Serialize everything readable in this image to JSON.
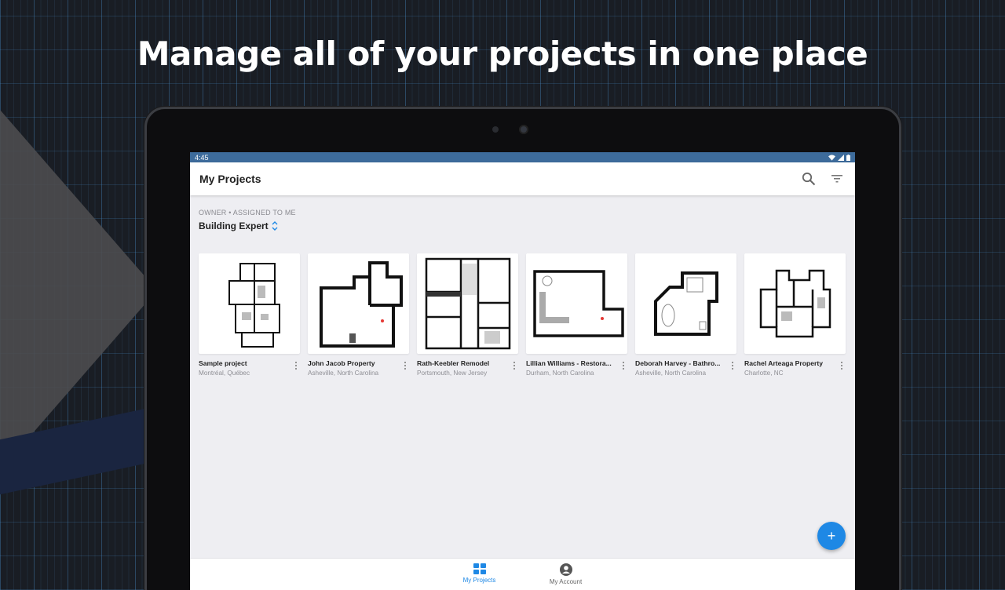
{
  "headline": "Manage all of your projects in one place",
  "status_bar": {
    "time": "4:45"
  },
  "app_bar": {
    "title": "My Projects",
    "search_icon": "search-icon",
    "filter_icon": "filter-icon"
  },
  "filter": {
    "label": "OWNER • ASSIGNED TO ME",
    "value": "Building Expert"
  },
  "projects": [
    {
      "title": "Sample project",
      "location": "Montréal, Québec"
    },
    {
      "title": "John Jacob Property",
      "location": "Asheville, North Carolina"
    },
    {
      "title": "Rath-Keebler Remodel",
      "location": "Portsmouth, New Jersey"
    },
    {
      "title": "Lillian Williams - Restora...",
      "location": "Durham, North Carolina"
    },
    {
      "title": "Deborah Harvey - Bathro...",
      "location": "Asheville, North Carolina"
    },
    {
      "title": "Rachel Arteaga Property",
      "location": "Charlotte, NC"
    }
  ],
  "fab": {
    "label": "+"
  },
  "bottom_nav": {
    "items": [
      {
        "label": "My Projects",
        "icon": "grid-icon",
        "active": true
      },
      {
        "label": "My Account",
        "icon": "account-icon",
        "active": false
      }
    ]
  },
  "colors": {
    "accent": "#1e88e5",
    "status_bar": "#3d6b9b",
    "background": "#eeeef2"
  }
}
